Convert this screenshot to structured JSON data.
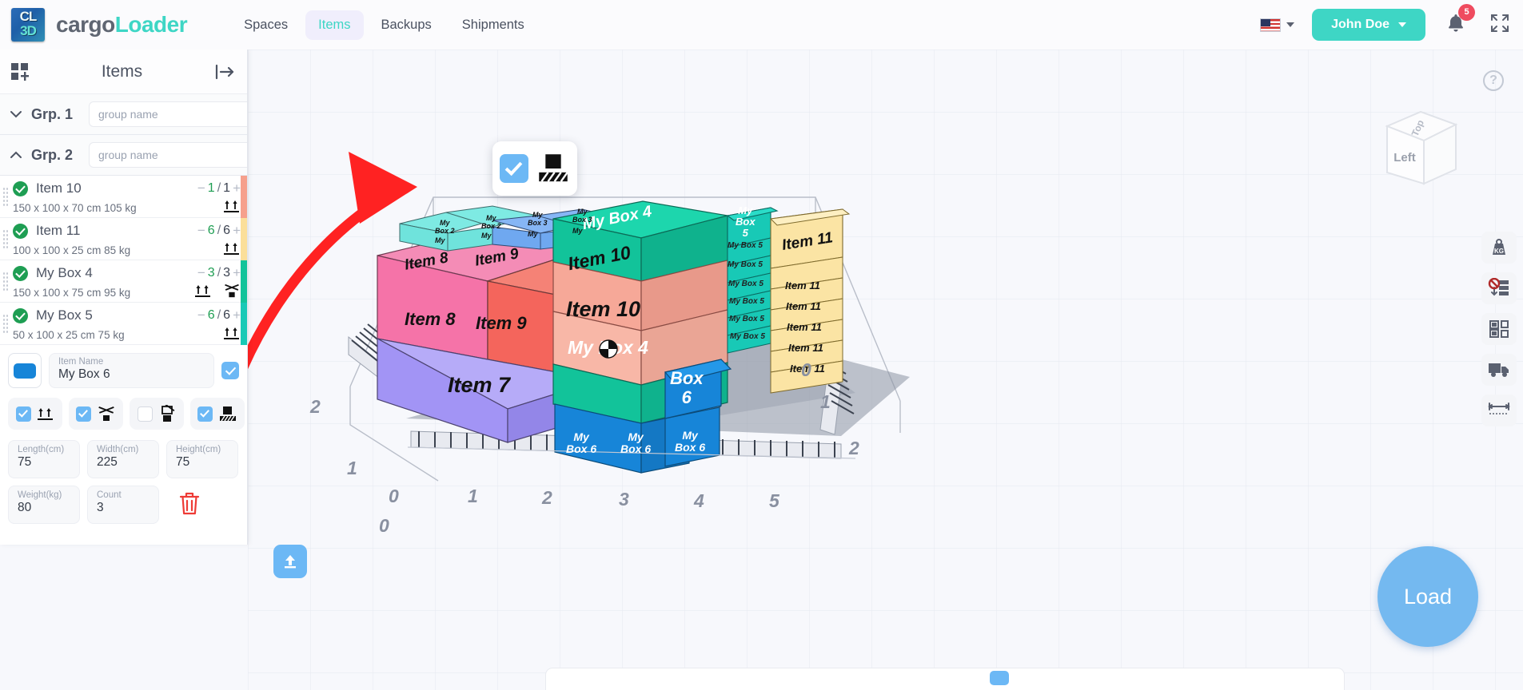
{
  "header": {
    "logo": {
      "line1": "CL",
      "line2": "3D",
      "icon": "cargoloader-logo-icon"
    },
    "brand_part1": "cargo",
    "brand_part2": "Loader",
    "nav": [
      {
        "label": "Spaces",
        "active": false
      },
      {
        "label": "Items",
        "active": true
      },
      {
        "label": "Backups",
        "active": false
      },
      {
        "label": "Shipments",
        "active": false
      }
    ],
    "language_flag": "us-flag-icon",
    "user_name": "John Doe",
    "notification_count": "5",
    "bell_icon": "bell-icon",
    "expand_icon": "fullscreen-expand-icon",
    "brand_color": "#3ed6c5",
    "badge_color": "#ef4b5f"
  },
  "sidebar": {
    "title": "Items",
    "add_items_icon": "add-grid-item-icon",
    "collapse_icon": "collapse-panel-icon",
    "groups": [
      {
        "label": "Grp. 1",
        "name_value": "",
        "name_placeholder": "group name",
        "expanded": false,
        "chevron": "chevron-down-icon",
        "remove_cube_icon": "cube-remove-icon",
        "add_cube_icon": "cube-add-icon"
      },
      {
        "label": "Grp. 2",
        "name_value": "",
        "name_placeholder": "group name",
        "expanded": true,
        "chevron": "chevron-up-icon",
        "remove_cube_icon": "cube-remove-icon",
        "add_cube_icon": "cube-add-icon"
      }
    ],
    "items": [
      {
        "name": "Item 10",
        "dims": "150 x 100 x 70 cm 105 kg",
        "count_current": "1",
        "count_total": "1",
        "minus": "−",
        "plus": "+",
        "color": "#f6a08c",
        "icons": [
          "this-way-up-icon"
        ],
        "checked": true
      },
      {
        "name": "Item 11",
        "dims": "100 x 100 x 25 cm 85 kg",
        "count_current": "6",
        "count_total": "6",
        "minus": "−",
        "plus": "+",
        "color": "#fbdf9a",
        "icons": [
          "this-way-up-icon"
        ],
        "checked": true
      },
      {
        "name": "My Box 4",
        "dims": "150 x 100 x 75 cm 95 kg",
        "count_current": "3",
        "count_total": "3",
        "minus": "−",
        "plus": "+",
        "color": "#12c39a",
        "icons": [
          "this-way-up-icon",
          "do-not-stack-icon"
        ],
        "checked": true
      },
      {
        "name": "My Box 5",
        "dims": "50 x 100 x 25 cm 75 kg",
        "count_current": "6",
        "count_total": "6",
        "minus": "−",
        "plus": "+",
        "color": "#18c9b6",
        "icons": [
          "this-way-up-icon"
        ],
        "checked": true
      }
    ],
    "detail": {
      "swatch_color": "#1785d8",
      "name_label": "Item Name",
      "name_value": "My Box 6",
      "name_confirm_icon": "check-icon",
      "flags": [
        {
          "checked": true,
          "icon": "this-way-up-icon"
        },
        {
          "checked": true,
          "icon": "do-not-stack-icon"
        },
        {
          "checked": false,
          "icon": "no-stack-box-icon"
        },
        {
          "checked": true,
          "icon": "floor-load-icon"
        }
      ],
      "fields": [
        {
          "label": "Length(cm)",
          "value": "75"
        },
        {
          "label": "Width(cm)",
          "value": "225"
        },
        {
          "label": "Height(cm)",
          "value": "75"
        },
        {
          "label": "Weight(kg)",
          "value": "80"
        },
        {
          "label": "Count",
          "value": "3"
        }
      ],
      "delete_icon": "trash-icon",
      "delete_color": "#ee3b36"
    }
  },
  "viewport": {
    "help_icon": "help-question-icon",
    "help_label": "?",
    "viewcube": {
      "top_label": "Top",
      "front_label": "Left"
    },
    "popup": {
      "checked": true,
      "icon": "floor-load-icon"
    },
    "tools": [
      {
        "icon": "weight-kg-icon",
        "label": "KG"
      },
      {
        "icon": "no-stacking-down-icon",
        "label": ""
      },
      {
        "icon": "layout-grid-icon",
        "label": ""
      },
      {
        "icon": "truck-icon",
        "label": ""
      },
      {
        "icon": "measure-ruler-icon",
        "label": ""
      }
    ],
    "load_button": "Load",
    "upload_icon": "upload-icon",
    "annotation_arrow": "red-arrow-annotation",
    "cursor_icon": "move-cursor-icon",
    "axis_labels_x": [
      "0",
      "1",
      "2",
      "3",
      "4",
      "5"
    ],
    "axis_labels_left": [
      "0",
      "1",
      "2"
    ],
    "axis_labels_right": [
      "0",
      "1",
      "2"
    ],
    "axis_origin": "0",
    "boxes": [
      {
        "label": "My Box 4",
        "color": "#12c39a"
      },
      {
        "label": "Item 10",
        "color": "#f6a898"
      },
      {
        "label": "Item 10",
        "color": "#f7b4a4"
      },
      {
        "label": "My Box 4",
        "color": "#12c39a"
      },
      {
        "label": "Item 8",
        "color": "#f573a8"
      },
      {
        "label": "Item 9",
        "color": "#f4655c"
      },
      {
        "label": "Item 7",
        "color": "#a294f5"
      },
      {
        "label": "My Box 6",
        "color": "#1785d8"
      },
      {
        "label": "My Box 6",
        "color": "#1785d8"
      },
      {
        "label": "My Box 6",
        "color": "#1785d8"
      },
      {
        "label": "Box 6",
        "color": "#1785d8"
      },
      {
        "label": "My Box 5",
        "color": "#18c9b6"
      },
      {
        "label": "Item 11",
        "color": "#fbe4a4"
      },
      {
        "label": "My Box 2",
        "color": "#6fe3dc"
      },
      {
        "label": "My Box 3",
        "color": "#6fa8f0"
      }
    ]
  }
}
